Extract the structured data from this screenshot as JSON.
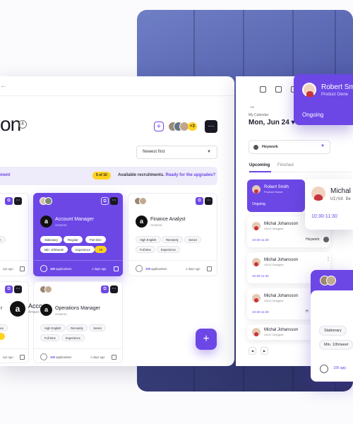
{
  "header": {
    "title": "on",
    "count": "4",
    "more_count": "+3",
    "sort_value": "Newest first"
  },
  "banner": {
    "left_text": "ment",
    "chip": "5 of 10",
    "text": "Available recruitments.",
    "link": "Ready for the upgrades?"
  },
  "cards": [
    {
      "title": "Account Manager",
      "company": "Amazon",
      "tags": [
        "Stationary",
        "Regular",
        "Part time",
        "Min. 10h/week",
        "Experience",
        "+3"
      ],
      "apps_count": "100",
      "apps_label": "applications",
      "ago": "1 days ago"
    },
    {
      "title": "Finance Analyst",
      "company": "Amazon",
      "tags": [
        "High English",
        "Remotely",
        "Senior",
        "Full time",
        "Experience"
      ],
      "apps_count": "100",
      "apps_label": "applications",
      "ago": "1 days ago"
    },
    {
      "title": "Operations Manager",
      "company": "Amazon",
      "tags": [
        "High English",
        "Remotely",
        "Senior",
        "Full time",
        "Experience"
      ],
      "apps_count": "100",
      "apps_label": "applications",
      "ago": "1 days ago"
    }
  ],
  "left_partial": {
    "tag1": "ion",
    "ago1": "ays ago",
    "letter": "r",
    "tag2": "ence",
    "ago2": "ays ago"
  },
  "calendar": {
    "label": "My Calendar",
    "date": "Mon, Jun 24",
    "select_value": "Heywork",
    "tab_upcoming": "Upcoming",
    "tab_finished": "Finished"
  },
  "events": [
    {
      "name": "Robert Smith",
      "role": "Product Owner",
      "status": "Ongoing"
    },
    {
      "name": "Michal Johansson",
      "role": "UI/UX Designer",
      "time": "10:30-11:30",
      "place": "Heywork"
    },
    {
      "name": "Michal Johansson",
      "role": "UI/UX Designer",
      "time": "10:30-11:30"
    },
    {
      "name": "Michal Johansson",
      "role": "UI/UX Designer",
      "time": "10:30-11:30",
      "place": "H"
    },
    {
      "name": "Michal Johansson",
      "role": "UI/UX Designer",
      "time": "10:30-11:30"
    }
  ],
  "popups": {
    "robert": {
      "name": "Robert Sm",
      "role": "Product Owne",
      "status": "Ongoing"
    },
    "michal": {
      "name": "Michal",
      "role": "UI/UX De",
      "time": "10:30-11:30"
    },
    "job": {
      "title": "Acco",
      "company": "Amazo",
      "tags": [
        "Stationary",
        "Min. 10h/weel"
      ],
      "apps": "100 app"
    }
  },
  "colors": {
    "accent": "#6c47e6",
    "highlight": "#ffd21e",
    "dark": "#191923"
  },
  "icons": [
    "search-icon",
    "chat-icon",
    "bell-icon",
    "copy-icon",
    "more-icon",
    "plus-icon",
    "calendar-icon",
    "chevron-down-icon",
    "arrow-right-icon"
  ]
}
